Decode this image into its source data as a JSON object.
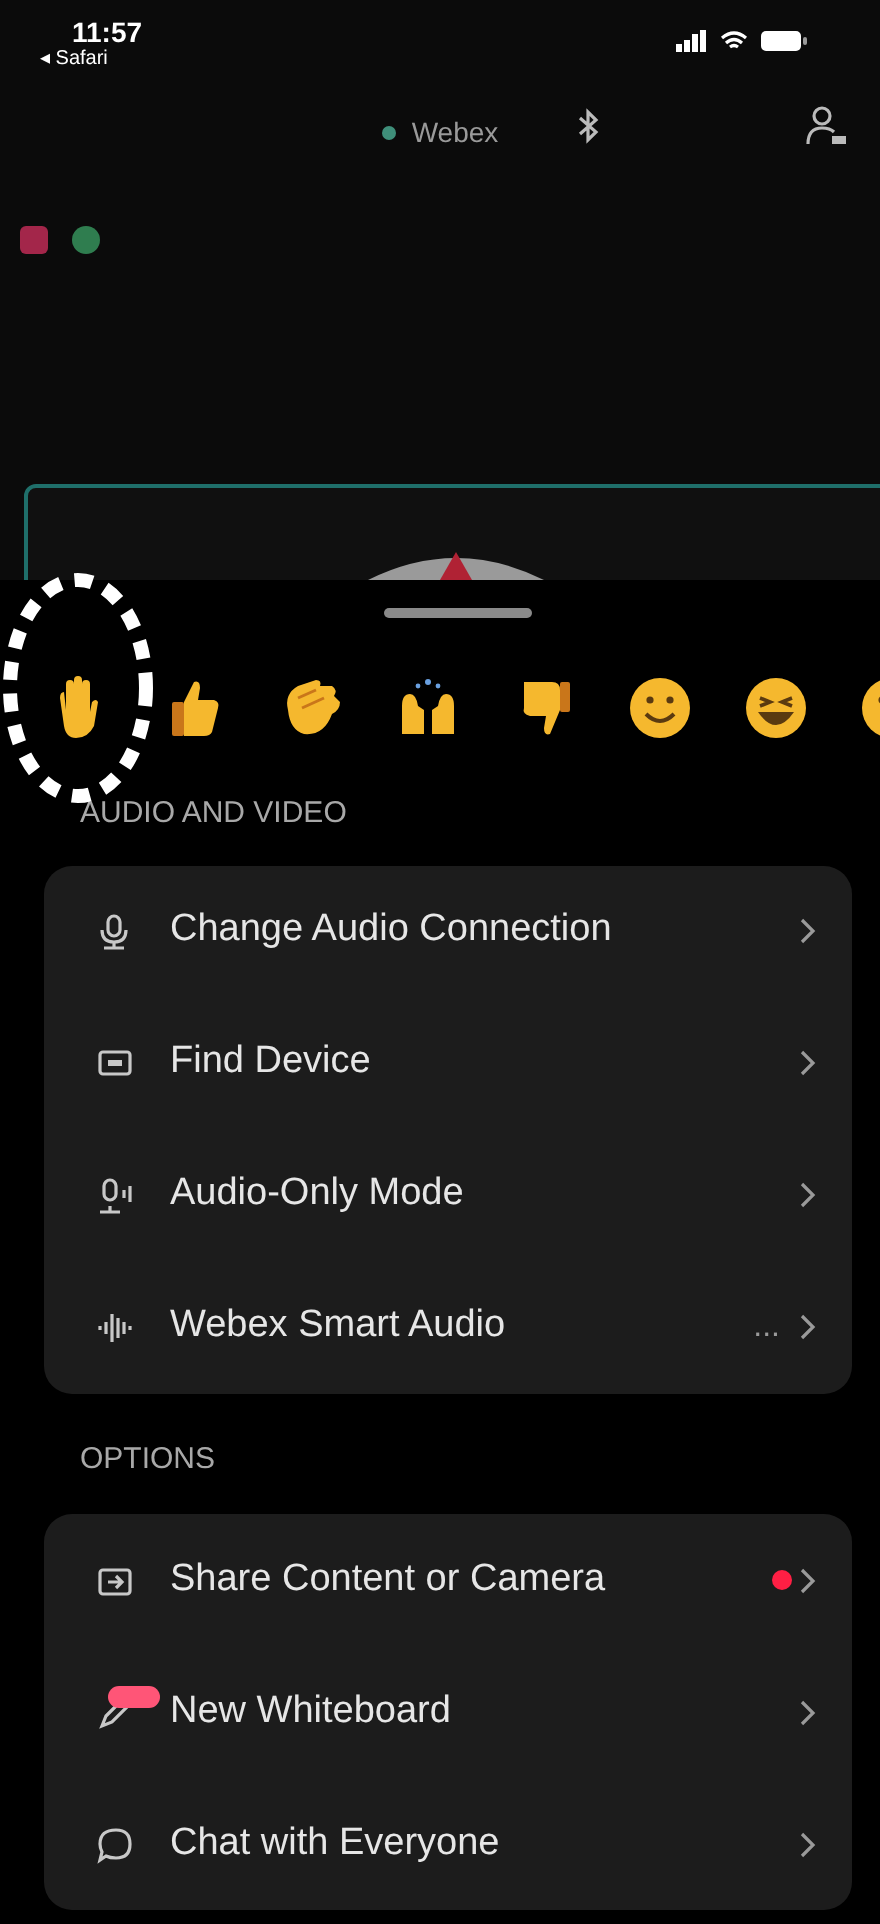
{
  "status_bar": {
    "time": "11:57",
    "back_app": "◂ Safari"
  },
  "header": {
    "title": "Webex"
  },
  "sections": [
    {
      "title": "AUDIO AND VIDEO",
      "items": [
        {
          "kind": "audio-connection",
          "label": "Change Audio Connection"
        },
        {
          "kind": "device",
          "label": "Find Device"
        },
        {
          "kind": "audio-only",
          "label": "Audio-Only Mode"
        },
        {
          "kind": "smart-audio",
          "label": "Webex Smart Audio",
          "value": "..."
        }
      ]
    },
    {
      "title": "OPTIONS",
      "items": [
        {
          "kind": "share",
          "label": "Share Content or Camera",
          "alert": true
        },
        {
          "kind": "whiteboard",
          "label": "New Whiteboard",
          "new_badge": true
        },
        {
          "kind": "chat",
          "label": "Chat with Everyone"
        }
      ]
    }
  ]
}
